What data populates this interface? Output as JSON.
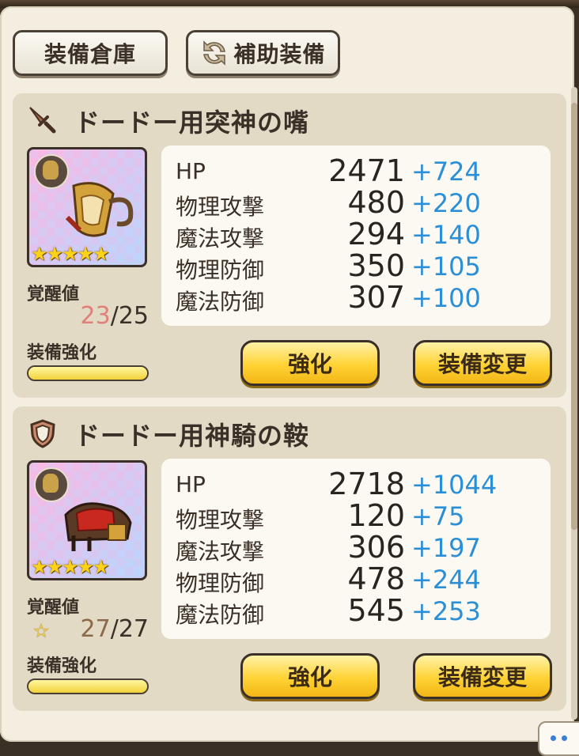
{
  "tabs": {
    "storage_label": "装備倉庫",
    "sub_equip_label": "補助装備"
  },
  "colors": {
    "bonus": "#2a8fd6",
    "button": "#ffd335",
    "awaken_current_1": "#e0807a"
  },
  "items": [
    {
      "type_icon": "dagger-icon",
      "name": "ドードー用突神の嘴",
      "stars": "★★★★★",
      "awaken_label": "覚醒値",
      "awaken_current": "23",
      "awaken_max": "/25",
      "enhance_label": "装備強化",
      "enhance_progress": 1.0,
      "stats": [
        {
          "name": "HP",
          "value": "2471",
          "bonus": "+724"
        },
        {
          "name": "物理攻撃",
          "value": "480",
          "bonus": "+220"
        },
        {
          "name": "魔法攻撃",
          "value": "294",
          "bonus": "+140"
        },
        {
          "name": "物理防御",
          "value": "350",
          "bonus": "+105"
        },
        {
          "name": "魔法防御",
          "value": "307",
          "bonus": "+100"
        }
      ],
      "enhance_button": "強化",
      "change_button": "装備変更"
    },
    {
      "type_icon": "shield-icon",
      "name": "ドードー用神騎の鞍",
      "stars": "★★★★★",
      "awaken_label": "覚醒値",
      "awaken_current": "27",
      "awaken_max": "/27",
      "enhance_label": "装備強化",
      "enhance_progress": 1.0,
      "stats": [
        {
          "name": "HP",
          "value": "2718",
          "bonus": "+1044"
        },
        {
          "name": "物理攻撃",
          "value": "120",
          "bonus": "+75"
        },
        {
          "name": "魔法攻撃",
          "value": "306",
          "bonus": "+197"
        },
        {
          "name": "物理防御",
          "value": "478",
          "bonus": "+244"
        },
        {
          "name": "魔法防御",
          "value": "545",
          "bonus": "+253"
        }
      ],
      "enhance_button": "強化",
      "change_button": "装備変更"
    }
  ]
}
